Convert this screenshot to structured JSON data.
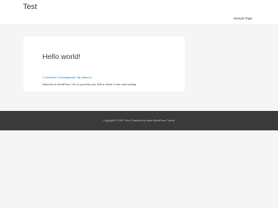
{
  "header": {
    "site_title": "Test",
    "nav": [
      {
        "label": "Sample Page"
      }
    ]
  },
  "post": {
    "title": "Hello world!",
    "meta": {
      "comments": "1 Comment",
      "separator_1": " / ",
      "category": "Uncategorized",
      "separator_2": " / ",
      "by": "By ",
      "author": "nathan.d"
    },
    "excerpt": "Welcome to WordPress. This is your first post. Edit or delete it, then start writing!"
  },
  "footer": {
    "text": "Copyright © 2020 Test | Powered by Astra WordPress Theme"
  },
  "colors": {
    "background": "#f5f5f5",
    "card": "#ffffff",
    "link": "#0274be",
    "footer_bg": "#3a3a3a",
    "footer_text": "#c8c8c8",
    "text": "#3a3a3a"
  }
}
